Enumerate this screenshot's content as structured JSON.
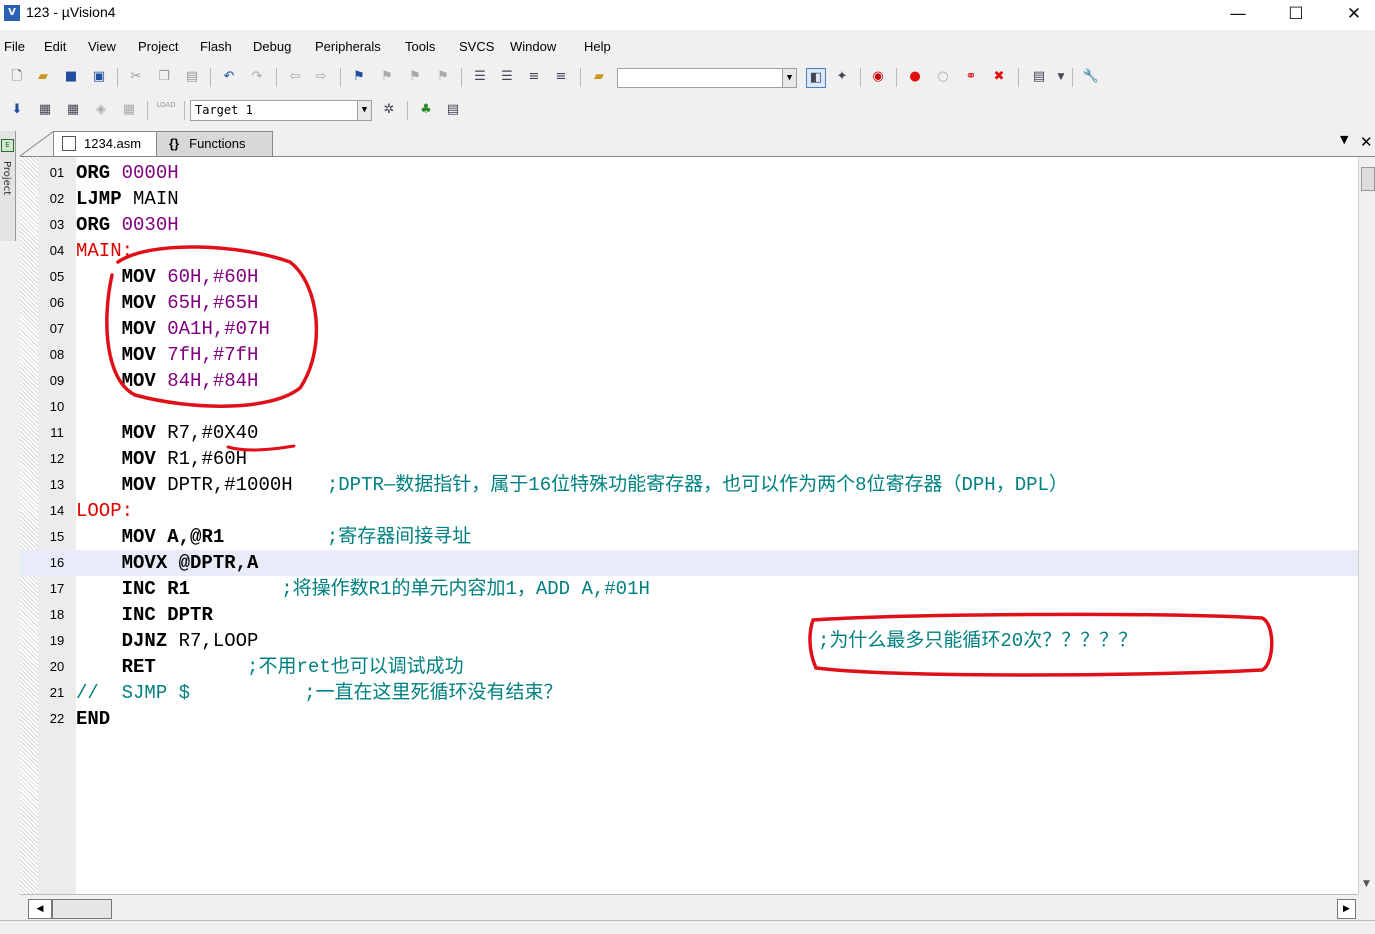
{
  "window": {
    "title": "123  - µVision4",
    "minimize": "—",
    "maximize": "☐",
    "close": "✕"
  },
  "menu": [
    "File",
    "Edit",
    "View",
    "Project",
    "Flash",
    "Debug",
    "Peripherals",
    "Tools",
    "SVCS",
    "Window",
    "Help"
  ],
  "toolbar2": {
    "load_label": "LOAD",
    "target_value": "Target 1"
  },
  "sidebar": {
    "label": "Project"
  },
  "tabs": [
    {
      "label": "1234.asm"
    },
    {
      "label": "Functions",
      "icon": "{}"
    }
  ],
  "tab_controls": {
    "dropdown": "▼",
    "close": "✕"
  },
  "code_lines": [
    {
      "num": "01",
      "label": "",
      "mnemonic": "ORG",
      "operands": "0000H",
      "comment": ""
    },
    {
      "num": "02",
      "label": "",
      "mnemonic": "LJMP",
      "operands": "MAIN",
      "comment": ""
    },
    {
      "num": "03",
      "label": "",
      "mnemonic": "ORG",
      "operands": "0030H",
      "comment": ""
    },
    {
      "num": "04",
      "label": "MAIN:",
      "mnemonic": "",
      "operands": "",
      "comment": ""
    },
    {
      "num": "05",
      "label": "",
      "mnemonic": "MOV",
      "operands": "60H,#60H",
      "comment": ""
    },
    {
      "num": "06",
      "label": "",
      "mnemonic": "MOV",
      "operands": "65H,#65H",
      "comment": ""
    },
    {
      "num": "07",
      "label": "",
      "mnemonic": "MOV",
      "operands": "0A1H,#07H",
      "comment": ""
    },
    {
      "num": "08",
      "label": "",
      "mnemonic": "MOV",
      "operands": "7fH,#7fH",
      "comment": ""
    },
    {
      "num": "09",
      "label": "",
      "mnemonic": "MOV",
      "operands": "84H,#84H",
      "comment": ""
    },
    {
      "num": "10",
      "label": "",
      "mnemonic": "",
      "operands": "",
      "comment": ""
    },
    {
      "num": "11",
      "label": "",
      "mnemonic": "MOV",
      "operands": "R7,#0X40",
      "comment": ""
    },
    {
      "num": "12",
      "label": "",
      "mnemonic": "MOV",
      "operands": "R1,#60H",
      "comment": ""
    },
    {
      "num": "13",
      "label": "",
      "mnemonic": "MOV",
      "operands": "DPTR,#1000H",
      "comment": ";DPTR—数据指针，属于16位特殊功能寄存器，也可以作为两个8位寄存器（DPH，DPL）"
    },
    {
      "num": "14",
      "label": "LOOP:",
      "mnemonic": "",
      "operands": "",
      "comment": ""
    },
    {
      "num": "15",
      "label": "",
      "mnemonic": "MOV",
      "operands": "A,@R1",
      "comment": ";寄存器间接寻址"
    },
    {
      "num": "16",
      "label": "",
      "mnemonic": "MOVX",
      "operands": "@DPTR,A",
      "comment": ""
    },
    {
      "num": "17",
      "label": "",
      "mnemonic": "INC",
      "operands": "R1",
      "comment": ";将操作数R1的单元内容加1，ADD A,#01H"
    },
    {
      "num": "18",
      "label": "",
      "mnemonic": "INC",
      "operands": "DPTR",
      "comment": ""
    },
    {
      "num": "19",
      "label": "",
      "mnemonic": "DJNZ",
      "operands": "R7,LOOP",
      "comment": ";为什么最多只能循环20次？？？？？"
    },
    {
      "num": "20",
      "label": "",
      "mnemonic": "RET",
      "operands": "",
      "comment": ";不用ret也可以调试成功"
    },
    {
      "num": "21",
      "label": "//",
      "mnemonic": "SJMP",
      "operands": "$",
      "comment": ";一直在这里死循环没有结束？"
    },
    {
      "num": "22",
      "label": "",
      "mnemonic": "END",
      "operands": "",
      "comment": ""
    }
  ],
  "colors": {
    "label": "#e00000",
    "number": "#800080",
    "comment": "#008080",
    "annotation": "#e0101a",
    "current_line": "#e8ecf8"
  }
}
